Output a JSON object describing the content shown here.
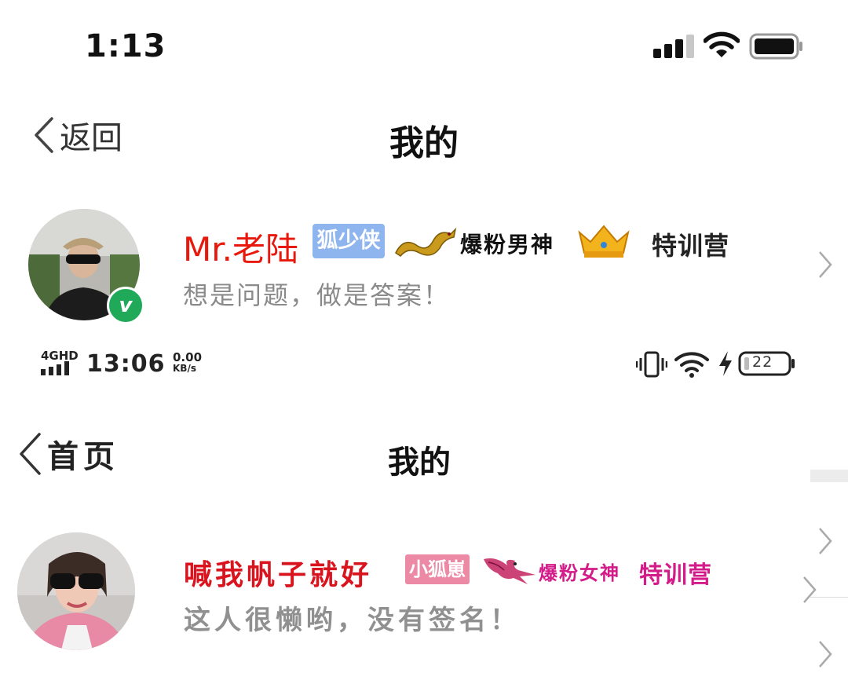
{
  "status_bar_ios": {
    "time": "1:13"
  },
  "nav1": {
    "back_label": "返回",
    "title": "我的"
  },
  "profile1": {
    "name": "Mr.老陆",
    "badge_fox": "狐少侠",
    "fans_title": "爆粉男神",
    "camp_label": "特训营",
    "signature": "想是问题，做是答案！",
    "verified_mark": "v"
  },
  "status_bar_android": {
    "network": "4GHD",
    "time": "13:06",
    "speed_value": "0.00",
    "speed_unit": "KB/s",
    "battery": "22"
  },
  "nav2": {
    "back_label": "首页",
    "title": "我的"
  },
  "profile2": {
    "name": "喊我帆子就好",
    "badge_fox": "小狐崽",
    "fans_title": "爆粉女神",
    "camp_label": "特训营",
    "signature": "这人很懒哟，没有签名！"
  },
  "colors": {
    "name1": "#e8190c",
    "name2": "#d9141e",
    "badge_fox1": "#8fb5ee",
    "badge_fox2": "#ec8aa6",
    "verified": "#1fa959",
    "pink_title": "#d31c8a"
  },
  "icons": [
    "signal-icon",
    "wifi-icon",
    "battery-icon",
    "back-chevron-icon",
    "dragon-icon",
    "crown-icon",
    "chevron-right-icon",
    "vibrate-icon",
    "charging-bolt-icon",
    "bird-icon"
  ]
}
